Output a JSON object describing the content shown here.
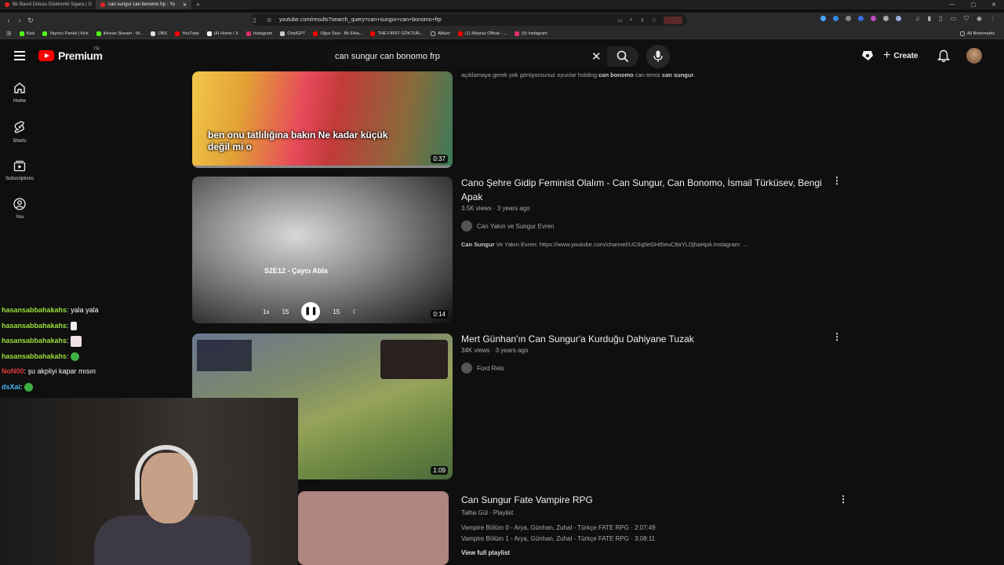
{
  "browser": {
    "tabs": [
      {
        "title": "Bir Bavul Dolusu Elektronik Sigara | G",
        "active": false
      },
      {
        "title": "can sungur can bonomo frp - Yo",
        "active": true
      }
    ],
    "url": "youtube.com/results?search_query=can+sungur+can+bonomo+frp",
    "bookmarks": [
      "Kick",
      "Yayıncı Paneli | Kick",
      "ikinsan Stream - W...",
      "OBS",
      "YouTube",
      "(4) Home / X",
      "Instagram",
      "ChatGPT",
      "Oğuz Sasi - Bir Efsa...",
      "THE FIRST GÖKTUR...",
      "Albüm",
      "(1) Mepraz Offical - ...",
      "(9) Instagram"
    ],
    "all_bookmarks": "All Bookmarks"
  },
  "header": {
    "logo_text": "Premium",
    "country_code": "TR",
    "search_value": "can sungur can bonomo frp",
    "create_label": "Create"
  },
  "sidebar": {
    "items": [
      {
        "label": "Home",
        "icon": "home-icon"
      },
      {
        "label": "Shorts",
        "icon": "shorts-icon"
      },
      {
        "label": "Subscriptions",
        "icon": "subscriptions-icon"
      },
      {
        "label": "You",
        "icon": "you-icon"
      }
    ]
  },
  "results": [
    {
      "caption": "ben onu tatlılığına bakın Ne kadar küçük değil mi o",
      "duration": "0:37",
      "desc_prefix": "açıklamaya gerek yok görüyorsunuz oyunlar holding ",
      "desc_b1": "can bonomo",
      "desc_mid": " can temiz ",
      "desc_b2": "can sungur",
      "desc_end": "."
    },
    {
      "title": "Cano Şehre Gidip Feminist Olalım - Can Sungur, Can Bonomo, İsmail Türküsev, Bengi Apak",
      "views": "3.5K views",
      "age": "3 years ago",
      "channel": "Can Yakın ve Sungur Evren",
      "desc_bold": "Can Sungur",
      "desc_rest": " Ve Yakın Evren: https://www.youtube.com/channel/UC6q0eGHt5euC8aYLDjhaHpA Instagram: ...",
      "duration": "0:14",
      "overlay_text": "S2E12 - Çaycı Abla",
      "speed": "1x",
      "skip_back": "15",
      "skip_fwd": "15"
    },
    {
      "title": "Mert Günhan'ın Can Sungur'a Kurduğu Dahiyane Tuzak",
      "views": "34K views",
      "age": "3 years ago",
      "channel": "Ford Reis",
      "duration": "1:09"
    },
    {
      "title": "Can Sungur Fate Vampire RPG",
      "channel_line": "Talha Gül · Playlist",
      "item1": "Vampire Bölüm 0 - Arya, Günhan, Zuhal - Türkçe FATE RPG · 2:07:49",
      "item2": "Vampire Bölüm 1 - Arya, Günhan, Zuhal - Türkçe FATE RPG · 3:08:11",
      "view_full": "View full playlist"
    }
  ],
  "chat": [
    {
      "user": "hasansabbahakahs",
      "text": " yala yala",
      "color": "#9bde3a"
    },
    {
      "user": "hasansabbahakahs",
      "text": "",
      "emote": "#eeeeee",
      "color": "#9bde3a"
    },
    {
      "user": "hasansabbahakahs",
      "text": "",
      "emote": "#f0e0e8",
      "color": "#9bde3a"
    },
    {
      "user": "hasansabbahakahs",
      "text": "",
      "emote": "#3cb043",
      "color": "#9bde3a"
    },
    {
      "user": "NoN00",
      "text": " şu akpliyi kapar mısın",
      "color": "#e03b3b"
    },
    {
      "user": "dsXai",
      "text": " ",
      "emote": "#3cb043",
      "color": "#4ab6f2"
    }
  ]
}
